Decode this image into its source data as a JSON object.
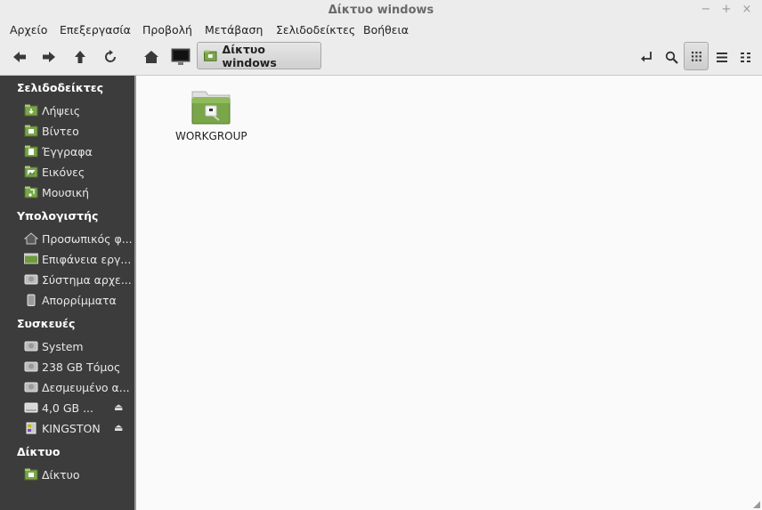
{
  "window": {
    "title": "Δίκτυο windows",
    "controls": [
      "−",
      "+",
      "×"
    ]
  },
  "menu": [
    "Αρχείο",
    "Επεξεργασία",
    "Προβολή",
    "Μετάβαση",
    "Σελιδοδείκτες",
    "Βοήθεια"
  ],
  "toolbar": {
    "location": "Δίκτυο windows"
  },
  "sidebar": {
    "bookmarks_header": "Σελιδοδείκτες",
    "bookmarks": [
      "Λήψεις",
      "Βίντεο",
      "Έγγραφα",
      "Εικόνες",
      "Μουσική"
    ],
    "computer_header": "Υπολογιστής",
    "computer": [
      "Προσωπικός φ...",
      "Επιφάνεια εργ...",
      "Σύστημα αρχε...",
      "Απορρίμματα"
    ],
    "devices_header": "Συσκευές",
    "devices": [
      "System",
      "238 GB Τόμος",
      "Δεσμευμένο α...",
      "4,0 GB ...",
      "KINGSTON"
    ],
    "eject_glyph": "⏏",
    "network_header": "Δίκτυο",
    "network": [
      "Δίκτυο"
    ]
  },
  "main": {
    "items": [
      {
        "label": "WORKGROUP",
        "icon": "network-folder-icon"
      }
    ]
  },
  "colors": {
    "sidebar_bg": "#3c3c3c",
    "folder_green": "#7aa64a",
    "window_bg": "#ececec"
  }
}
